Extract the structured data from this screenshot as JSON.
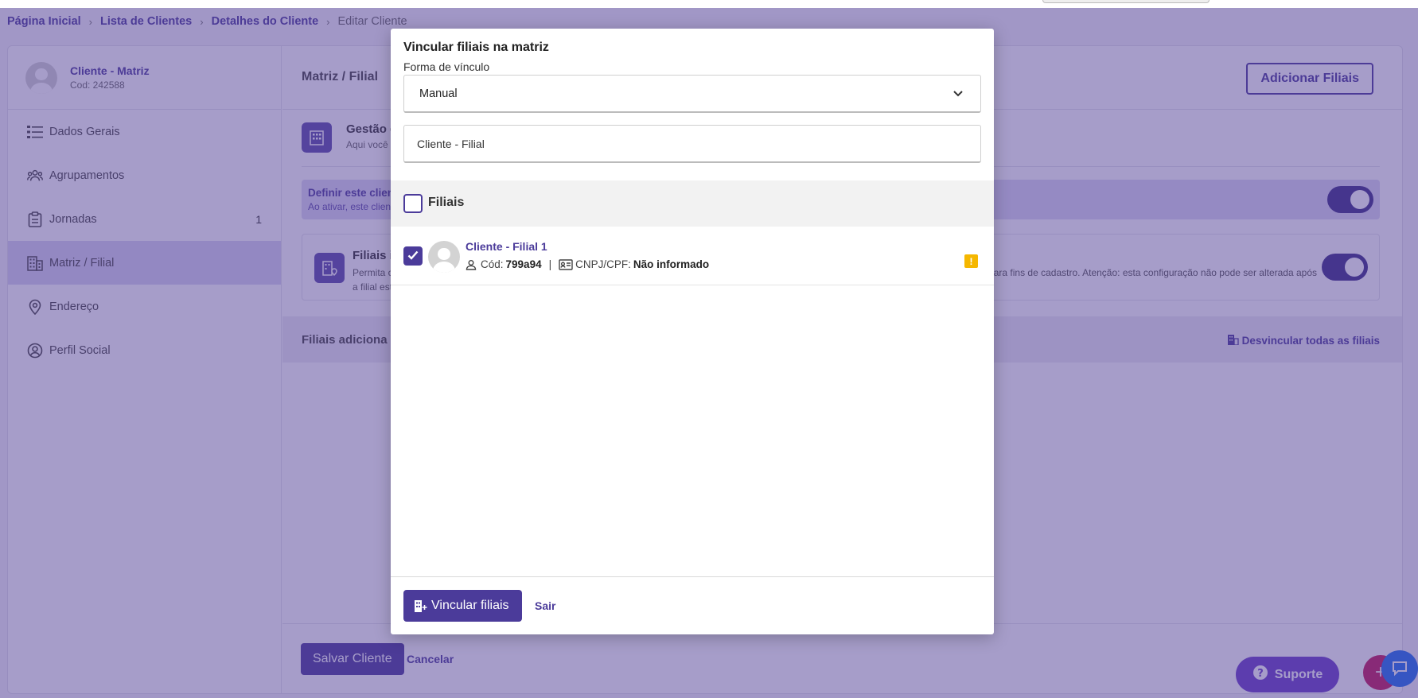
{
  "breadcrumb": {
    "items": [
      "Página Inicial",
      "Lista de Clientes",
      "Detalhes do Cliente"
    ],
    "current": "Editar Cliente",
    "separator": "›"
  },
  "client": {
    "name": "Cliente - Matriz",
    "code": "Cod: 242588"
  },
  "sidebar": {
    "items": [
      {
        "label": "Dados Gerais",
        "icon": "list-icon"
      },
      {
        "label": "Agrupamentos",
        "icon": "users-group-icon"
      },
      {
        "label": "Jornadas",
        "icon": "clipboard-icon",
        "badge": "1"
      },
      {
        "label": "Matriz / Filial",
        "icon": "building-icon",
        "active": true
      },
      {
        "label": "Endereço",
        "icon": "location-pin-icon"
      },
      {
        "label": "Perfil Social",
        "icon": "user-circle-icon"
      }
    ]
  },
  "main": {
    "title": "Matriz / Filial",
    "add_button": "Adicionar Filiais",
    "gestao_title": "Gestão de",
    "gestao_sub": "Aqui você po",
    "define_title": "Definir este client",
    "define_sub": "Ao ativar, este client",
    "filiais_title": "Filiais i",
    "filiais_sub1": "Permita c",
    "filiais_sub2": "a filial est",
    "filiais_sub_right": "s para fins de cadastro. Atenção: esta configuração não pode ser alterada após",
    "added_title": "Filiais adiciona",
    "unlink_all": "Desvincular todas as filiais",
    "save_button": "Salvar Cliente",
    "cancel_link": "Cancelar"
  },
  "support": {
    "label": "Suporte"
  },
  "modal": {
    "title": "Vincular filiais na matriz",
    "field_label": "Forma de vínculo",
    "select_value": "Manual",
    "search_value": "Cliente - Filial",
    "list_header": "Filiais",
    "rows": [
      {
        "name": "Cliente - Filial 1",
        "code_label": "Cód:",
        "code_value": "799a94",
        "doc_label": "CNPJ/CPF:",
        "doc_value": "Não informado",
        "checked": true,
        "warning": "!"
      }
    ],
    "primary_button": "Vincular filiais",
    "exit_link": "Sair"
  },
  "colors": {
    "brand": "#4b3b9a",
    "overlay": "#4e3c94",
    "warning": "#f5b700",
    "support": "#6a3fc9",
    "chat": "#1f6ff0"
  }
}
